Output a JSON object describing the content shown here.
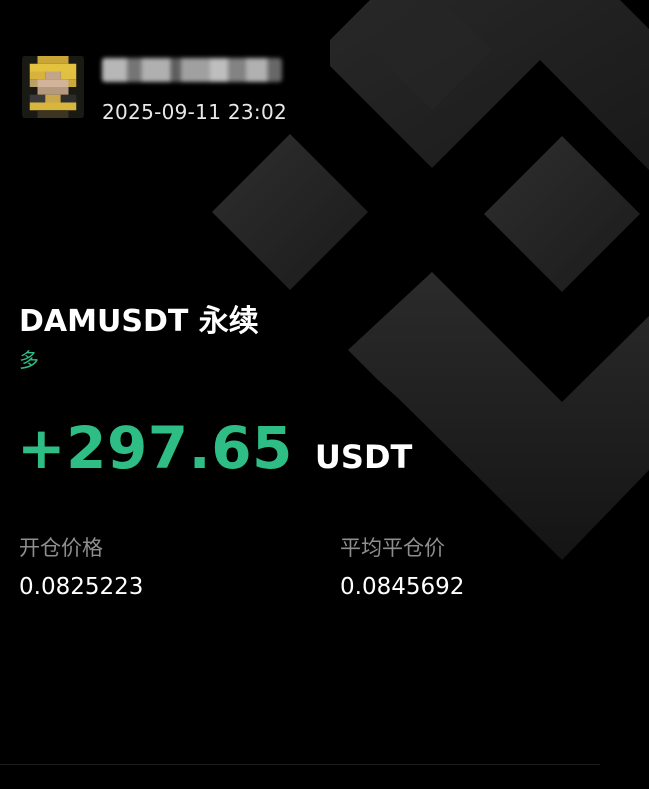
{
  "header": {
    "avatar": "pixelated-avatar",
    "username": "",
    "timestamp": "2025-09-11 23:02"
  },
  "position": {
    "pair": "DAMUSDT 永续",
    "side": "多",
    "pnl_value": "+297.65",
    "pnl_unit": "USDT"
  },
  "stats": {
    "open_label": "开仓价格",
    "open_value": "0.0825223",
    "close_label": "平均平仓价",
    "close_value": "0.0845692"
  },
  "colors": {
    "background": "#000000",
    "profit_green": "#2ebd85",
    "label_gray": "#8e8e8e",
    "logo_shape": "#2a2a2a"
  },
  "icons": {
    "background_logo": "exchange-logo-icon"
  }
}
